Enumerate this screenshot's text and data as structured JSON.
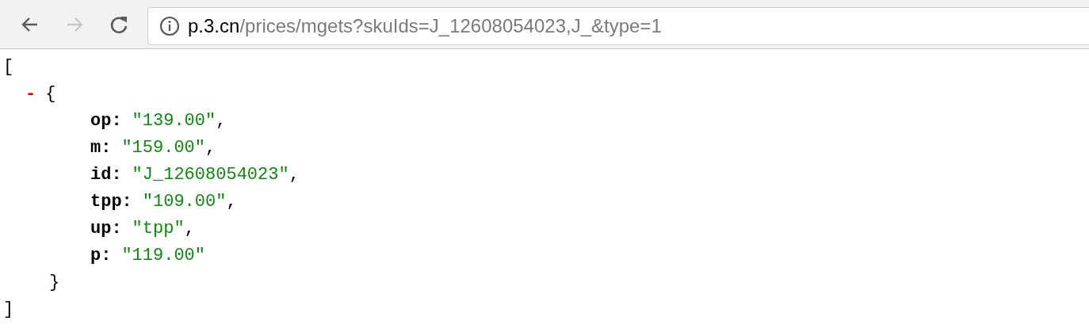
{
  "toolbar": {
    "nav_buttons": [
      {
        "kind": "back",
        "disabled": false
      },
      {
        "kind": "forward",
        "disabled": true
      },
      {
        "kind": "reload",
        "disabled": false
      }
    ],
    "address": {
      "host": "p.3.cn",
      "path": "/prices/mgets?skuIds=J_12608054023,J_&type=1"
    }
  },
  "viewer": {
    "open": "[",
    "toggle": "-",
    "object_open": "{",
    "entries": [
      {
        "key": "op:",
        "value": "\"139.00\"",
        "comma": ","
      },
      {
        "key": "m:",
        "value": "\"159.00\"",
        "comma": ","
      },
      {
        "key": "id:",
        "value": "\"J_12608054023\"",
        "comma": ","
      },
      {
        "key": "tpp:",
        "value": "\"109.00\"",
        "comma": ","
      },
      {
        "key": "up:",
        "value": "\"tpp\"",
        "comma": ","
      },
      {
        "key": "p:",
        "value": "\"119.00\""
      }
    ],
    "object_close": "}",
    "close": "]"
  }
}
